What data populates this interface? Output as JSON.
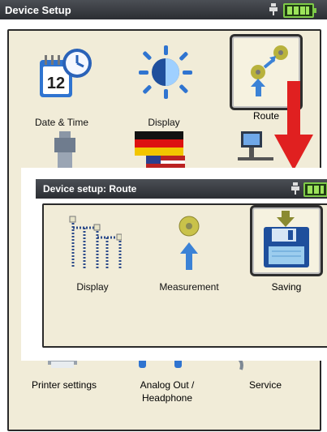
{
  "main": {
    "title": "Device Setup",
    "tiles": [
      {
        "label": "Date & Time",
        "icon": "calendar-clock-icon"
      },
      {
        "label": "Display",
        "icon": "brightness-icon"
      },
      {
        "label": "Route",
        "icon": "route-icon"
      },
      {
        "label": "Printer settings",
        "icon": "printer-icon"
      },
      {
        "label": "Analog Out /",
        "label2": "Headphone",
        "icon": "analog-out-icon"
      },
      {
        "label": "Service",
        "icon": "service-icon"
      }
    ],
    "calendar_day": "12"
  },
  "inset": {
    "title": "Device setup: Route",
    "tiles": [
      {
        "label": "Display",
        "icon": "route-display-icon"
      },
      {
        "label": "Measurement",
        "icon": "measurement-icon"
      },
      {
        "label": "Saving",
        "icon": "floppy-disk-icon"
      }
    ]
  },
  "colors": {
    "accent_arrow": "#e02020",
    "panel": "#f1ecd8",
    "titlebar": "#3a3d42"
  }
}
